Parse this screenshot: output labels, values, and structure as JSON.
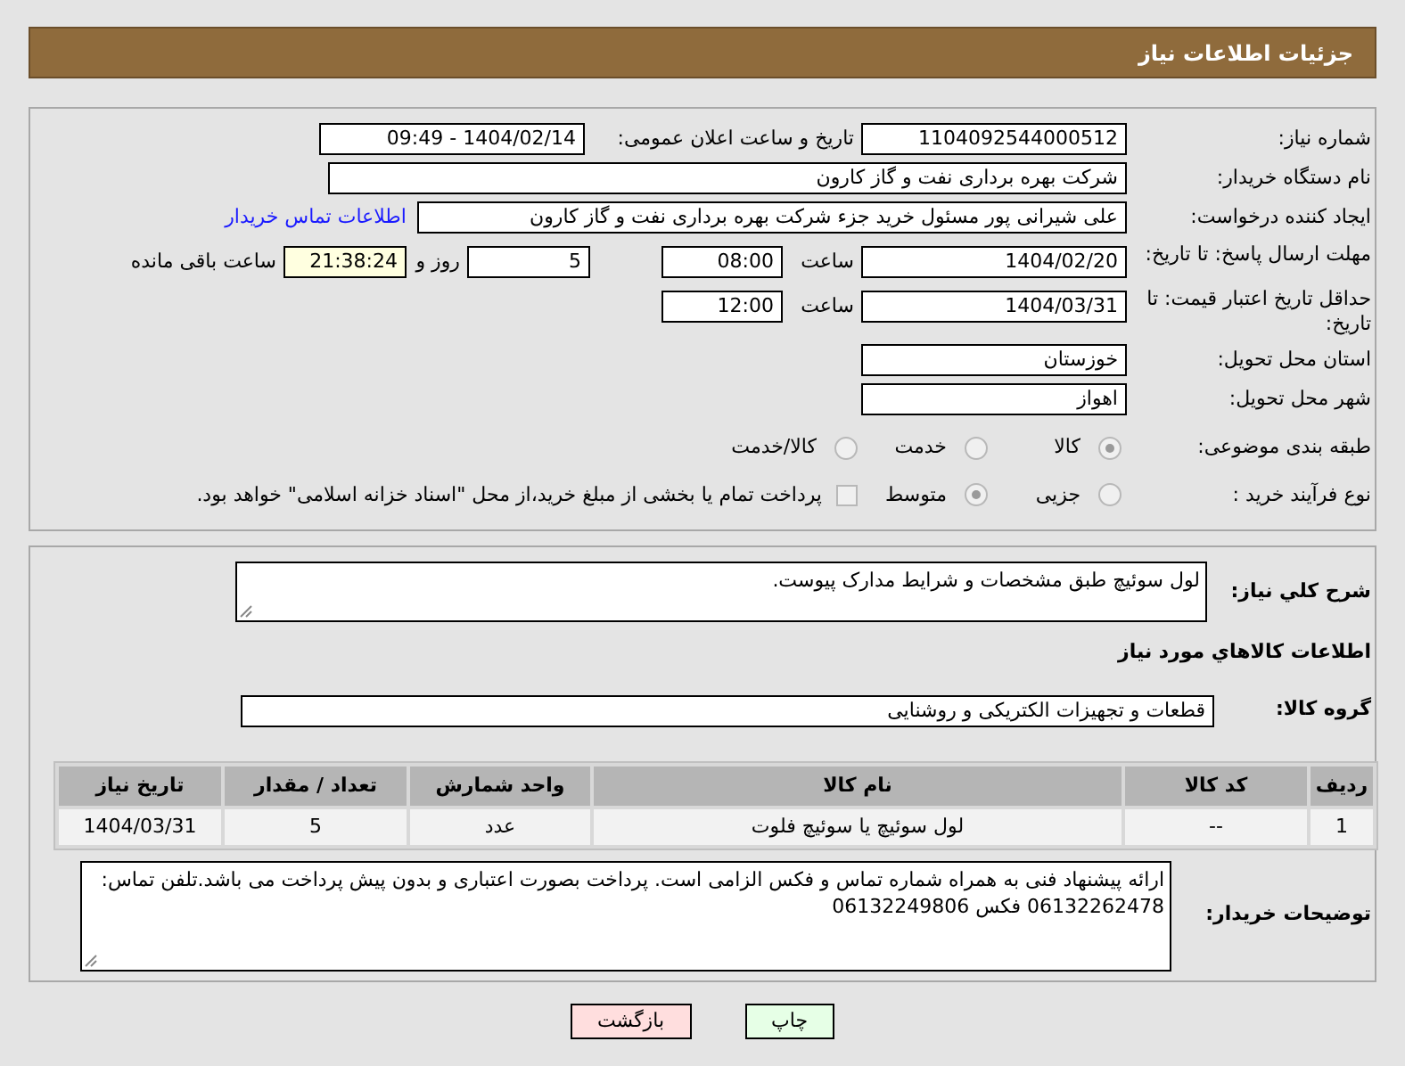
{
  "header": {
    "title": "جزئیات اطلاعات نیاز"
  },
  "need_number": {
    "label": "شماره نیاز:",
    "value": "1104092544000512"
  },
  "announce": {
    "label": "تاریخ و ساعت اعلان عمومی:",
    "value": "1404/02/14 - 09:49"
  },
  "buyer_org": {
    "label": "نام دستگاه خریدار:",
    "value": "شرکت بهره برداری نفت و گاز کارون"
  },
  "requester": {
    "label": "ایجاد کننده درخواست:",
    "value": "علی شیرانی پور مسئول خرید جزء شرکت بهره برداری نفت و گاز کارون",
    "link": "اطلاعات تماس خریدار"
  },
  "deadline": {
    "label": "مهلت ارسال پاسخ: تا تاریخ:",
    "date": "1404/02/20",
    "time_label": "ساعت",
    "time": "08:00",
    "days": "5",
    "days_label": "روز و",
    "remaining": "21:38:24",
    "remaining_label": "ساعت باقی مانده"
  },
  "validity": {
    "label": "حداقل تاریخ اعتبار قیمت: تا تاریخ:",
    "date": "1404/03/31",
    "time_label": "ساعت",
    "time": "12:00"
  },
  "province": {
    "label": "استان محل تحویل:",
    "value": "خوزستان"
  },
  "city": {
    "label": "شهر محل تحویل:",
    "value": "اهواز"
  },
  "category": {
    "label": "طبقه بندی موضوعی:",
    "options": [
      {
        "label": "کالا",
        "selected": true
      },
      {
        "label": "خدمت",
        "selected": false
      },
      {
        "label": "کالا/خدمت",
        "selected": false
      }
    ]
  },
  "process": {
    "label": "نوع فرآیند خرید :",
    "options": [
      {
        "label": "جزیی",
        "selected": false
      },
      {
        "label": "متوسط",
        "selected": true
      }
    ],
    "treasury": {
      "label": "پرداخت تمام یا بخشی از مبلغ خرید،از محل \"اسناد خزانه اسلامی\" خواهد بود.",
      "checked": false
    }
  },
  "description": {
    "label": "شرح کلي نياز:",
    "value": "لول سوئیچ طبق مشخصات و شرایط مدارک پیوست."
  },
  "items_heading": "اطلاعات كالاهاي مورد نياز",
  "goods_group": {
    "label": "گروه کالا:",
    "value": "قطعات و تجهیزات الکتریکی و روشنایی"
  },
  "table": {
    "columns": [
      "ردیف",
      "کد کالا",
      "نام کالا",
      "واحد شمارش",
      "تعداد / مقدار",
      "تاریخ نیاز"
    ],
    "rows": [
      [
        "1",
        "--",
        "لول سوئیچ یا سوئیچ فلوت",
        "عدد",
        "5",
        "1404/03/31"
      ]
    ]
  },
  "buyer_notes": {
    "label": "توضیحات خریدار:",
    "value": "ارائه پیشنهاد فنی به همراه شماره تماس و فکس الزامی است. پرداخت بصورت اعتباری و بدون پیش پرداخت می باشد.تلفن تماس: 06132262478 فکس 06132249806"
  },
  "buttons": [
    {
      "kind": "print",
      "label": "چاپ"
    },
    {
      "kind": "back",
      "label": "بازگشت"
    }
  ]
}
